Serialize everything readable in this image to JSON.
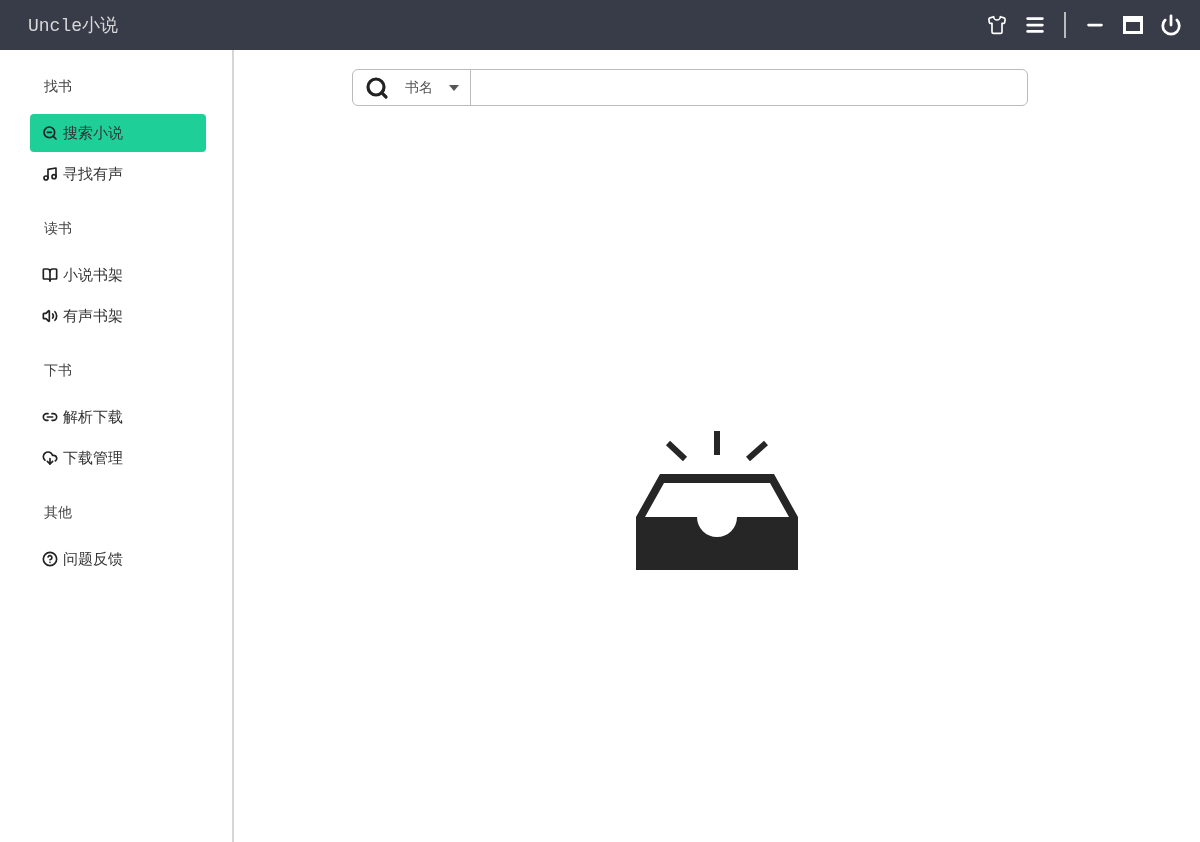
{
  "window": {
    "title": "Uncle小说"
  },
  "sidebar": {
    "groups": [
      {
        "label": "找书",
        "items": [
          {
            "label": "搜索小说",
            "selected": true
          },
          {
            "label": "寻找有声",
            "selected": false
          }
        ]
      },
      {
        "label": "读书",
        "items": [
          {
            "label": "小说书架",
            "selected": false
          },
          {
            "label": "有声书架",
            "selected": false
          }
        ]
      },
      {
        "label": "下书",
        "items": [
          {
            "label": "解析下载",
            "selected": false
          },
          {
            "label": "下载管理",
            "selected": false
          }
        ]
      },
      {
        "label": "其他",
        "items": [
          {
            "label": "问题反馈",
            "selected": false
          }
        ]
      }
    ]
  },
  "search": {
    "type_label": "书名"
  }
}
